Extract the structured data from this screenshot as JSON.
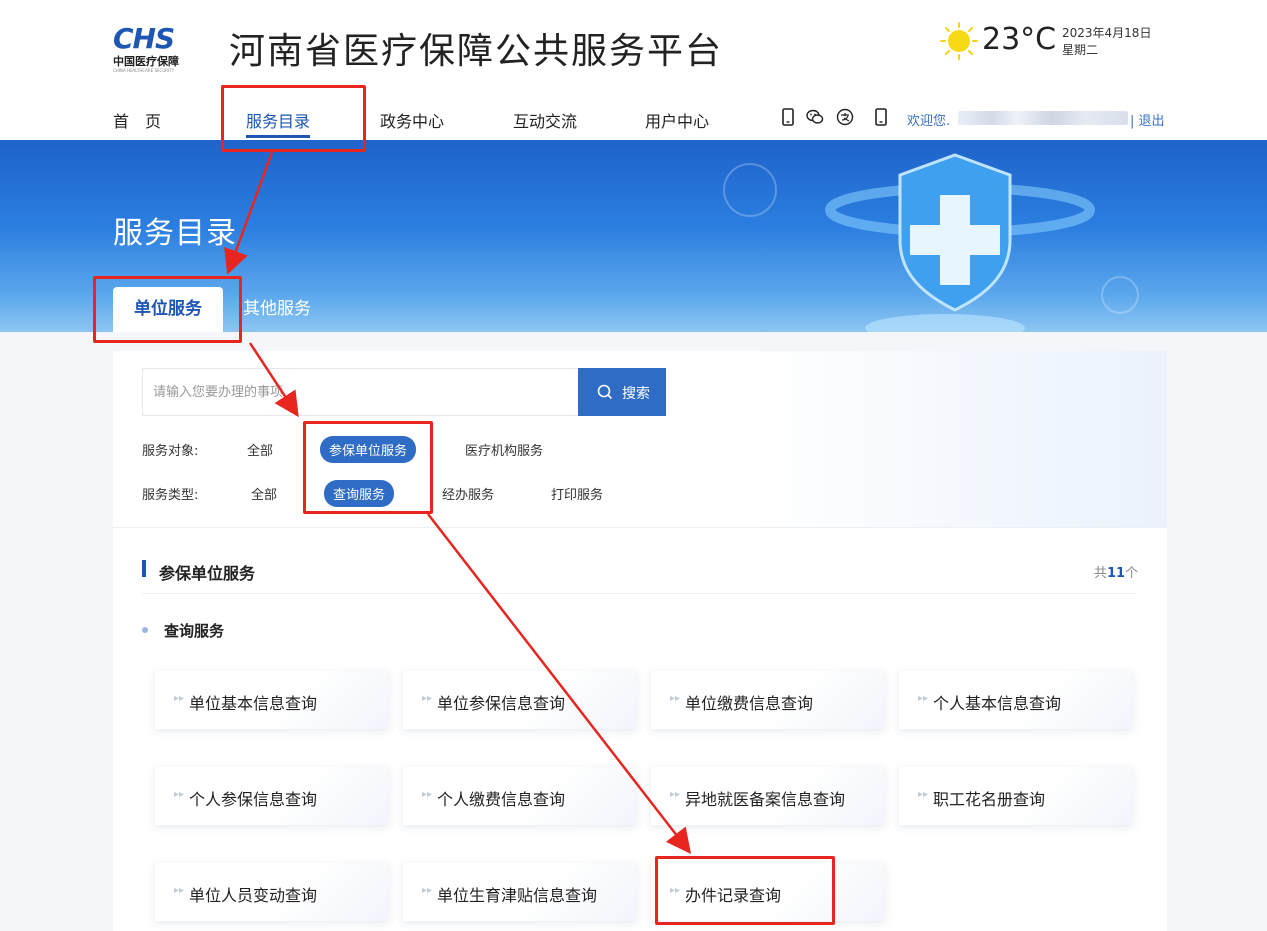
{
  "header": {
    "logo_mark": "CHS",
    "logo_cn": "中国医疗保障",
    "logo_en": "CHINA HEALTHCARE SECURITY",
    "site_title": "河南省医疗保障公共服务平台",
    "temperature": "23°C",
    "date": "2023年4月18日",
    "weekday": "星期二",
    "weather_icon": "sun-icon"
  },
  "nav": {
    "items": [
      {
        "label": "首　页"
      },
      {
        "label": "服务目录"
      },
      {
        "label": "政务中心"
      },
      {
        "label": "互动交流"
      },
      {
        "label": "用户中心"
      }
    ],
    "welcome": "欢迎您.",
    "logout": "| 退出",
    "icons": [
      "mobile-icon",
      "wechat-icon",
      "alipay-icon",
      "tablet-icon"
    ]
  },
  "banner": {
    "title": "服务目录",
    "tabs": [
      {
        "label": "单位服务"
      },
      {
        "label": "其他服务"
      }
    ]
  },
  "filters": {
    "search_placeholder": "请输入您要办理的事项",
    "search_button": "搜索",
    "target_label": "服务对象:",
    "target_options": [
      "全部",
      "参保单位服务",
      "医疗机构服务"
    ],
    "type_label": "服务类型:",
    "type_options": [
      "全部",
      "查询服务",
      "经办服务",
      "打印服务"
    ]
  },
  "section": {
    "title": "参保单位服务",
    "count_prefix": "共",
    "count_value": "11",
    "count_suffix": "个",
    "subsection": "查询服务"
  },
  "services": [
    "单位基本信息查询",
    "单位参保信息查询",
    "单位缴费信息查询",
    "个人基本信息查询",
    "个人参保信息查询",
    "个人缴费信息查询",
    "异地就医备案信息查询",
    "职工花名册查询",
    "单位人员变动查询",
    "单位生育津贴信息查询",
    "办件记录查询"
  ],
  "colors": {
    "brand": "#1d56b3",
    "accent": "#2f6cc6",
    "annotation": "#e8261f"
  }
}
